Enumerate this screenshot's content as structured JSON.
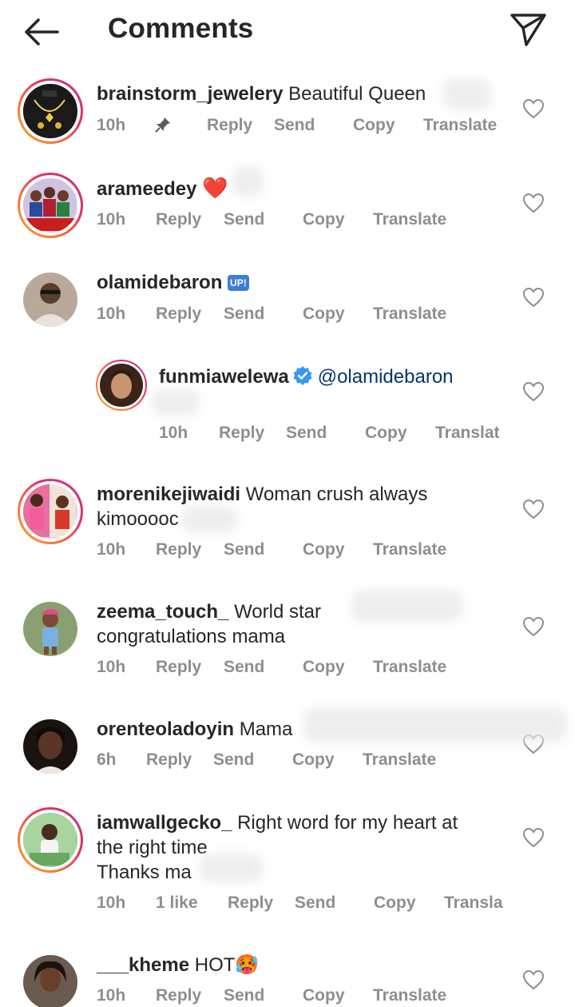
{
  "header": {
    "title": "Comments",
    "back_icon": "arrow-left-icon",
    "share_icon": "paper-plane-icon"
  },
  "comments": [
    {
      "username": "brainstorm_jewelery",
      "text": "Beautiful Queen",
      "time": "10h",
      "pinned": true,
      "reply": "Reply",
      "send": "Send",
      "copy": "Copy",
      "translate": "Translate"
    },
    {
      "username": "arameedey",
      "text": "❤️",
      "time": "10h",
      "reply": "Reply",
      "send": "Send",
      "copy": "Copy",
      "translate": "Translate"
    },
    {
      "username": "olamidebaron",
      "text": "UP!",
      "time": "10h",
      "reply": "Reply",
      "send": "Send",
      "copy": "Copy",
      "translate": "Translate"
    },
    {
      "username": "funmiawelewa",
      "verified": true,
      "text": "@olamidebaron",
      "time": "10h",
      "reply": "Reply",
      "send": "Send",
      "copy": "Copy",
      "translate": "Translat"
    },
    {
      "username": "morenikejiwaidi",
      "text": "Woman crush always",
      "text2": "kimooooc",
      "time": "10h",
      "reply": "Reply",
      "send": "Send",
      "copy": "Copy",
      "translate": "Translate"
    },
    {
      "username": "zeema_touch_",
      "text": "World star",
      "text2": "congratulations mama",
      "time": "10h",
      "reply": "Reply",
      "send": "Send",
      "copy": "Copy",
      "translate": "Translate"
    },
    {
      "username": "orenteoladoyin",
      "text": "Mama",
      "time": "6h",
      "reply": "Reply",
      "send": "Send",
      "copy": "Copy",
      "translate": "Translate"
    },
    {
      "username": "iamwallgecko_",
      "text": "Right word for my heart at",
      "text2": "the right time",
      "text3": "Thanks ma",
      "time": "10h",
      "likes": "1 like",
      "reply": "Reply",
      "send": "Send",
      "copy": "Copy",
      "translate": "Transla"
    },
    {
      "username": "___kheme",
      "text": "HOT🥵",
      "time": "10h",
      "reply": "Reply",
      "send": "Send",
      "copy": "Copy",
      "translate": "Translate"
    }
  ],
  "colors": {
    "text": "#262626",
    "meta": "#8e8e8e",
    "mention": "#00376b",
    "verified": "#3897f0",
    "ring_start": "#f9a825",
    "ring_end": "#c13584"
  }
}
